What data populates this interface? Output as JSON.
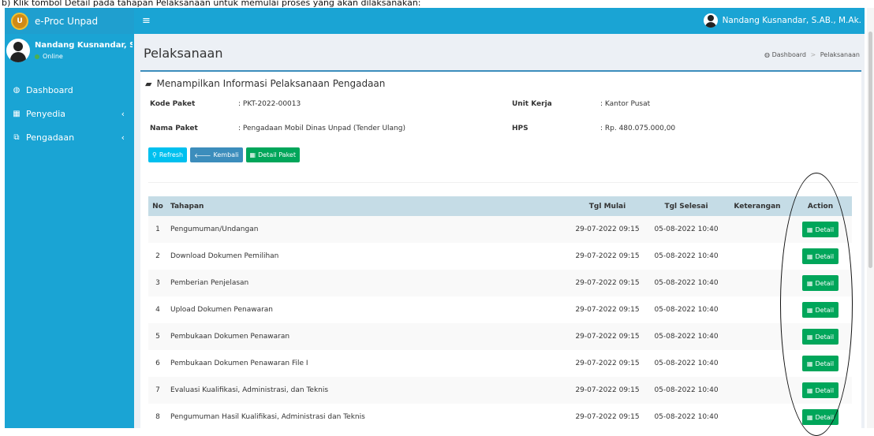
{
  "caption": "b) Klik tombol Detail pada tahapan Pelaksanaan untuk memulai proses yang akan dilaksanakan:",
  "brand": {
    "name": "e-Proc Unpad",
    "logo_text": "U"
  },
  "sidebar": {
    "user_name": "Nandang Kusnandar, S.AB.",
    "status": "Online",
    "menu": [
      {
        "icon": "dashboard-icon",
        "glyph": "◍",
        "label": "Dashboard",
        "chevron": ""
      },
      {
        "icon": "calendar-icon",
        "glyph": "▦",
        "label": "Penyedia",
        "chevron": "‹"
      },
      {
        "icon": "external-link-icon",
        "glyph": "⧉",
        "label": "Pengadaan",
        "chevron": "‹"
      }
    ]
  },
  "topbar": {
    "menu_glyph": "≡",
    "user_name": "Nandang Kusnandar, S.AB., M.Ak."
  },
  "page": {
    "title": "Pelaksanaan",
    "breadcrumb": {
      "home": "Dashboard",
      "separator": ">",
      "current": "Pelaksanaan",
      "home_glyph": "◍"
    }
  },
  "box": {
    "title": "Menampilkan Informasi Pelaksanaan Pengadaan",
    "title_glyph": "▰",
    "info": {
      "kode_paket_label": "Kode Paket",
      "kode_paket_value": ": PKT-2022-00013",
      "nama_paket_label": "Nama Paket",
      "nama_paket_value": ": Pengadaan Mobil Dinas Unpad (Tender Ulang)",
      "unit_kerja_label": "Unit Kerja",
      "unit_kerja_value": ": Kantor Pusat",
      "hps_label": "HPS",
      "hps_value": ": Rp. 480.075.000,00"
    },
    "buttons": {
      "refresh": "Refresh",
      "refresh_glyph": "⚲",
      "kembali": "Kembali",
      "kembali_glyph": "🡐",
      "detail_paket": "Detail Paket",
      "detail_paket_glyph": "▦"
    }
  },
  "table": {
    "headers": {
      "no": "No",
      "tahapan": "Tahapan",
      "tgl_mulai": "Tgl Mulai",
      "tgl_selesai": "Tgl Selesai",
      "keterangan": "Keterangan",
      "action": "Action"
    },
    "action_label": "Detail",
    "action_glyph": "▦",
    "rows": [
      {
        "no": "1",
        "tahapan": "Pengumuman/Undangan",
        "mulai": "29-07-2022 09:15",
        "selesai": "05-08-2022 10:40",
        "keterangan": ""
      },
      {
        "no": "2",
        "tahapan": "Download Dokumen Pemilihan",
        "mulai": "29-07-2022 09:15",
        "selesai": "05-08-2022 10:40",
        "keterangan": ""
      },
      {
        "no": "3",
        "tahapan": "Pemberian Penjelasan",
        "mulai": "29-07-2022 09:15",
        "selesai": "05-08-2022 10:40",
        "keterangan": ""
      },
      {
        "no": "4",
        "tahapan": "Upload Dokumen Penawaran",
        "mulai": "29-07-2022 09:15",
        "selesai": "05-08-2022 10:40",
        "keterangan": ""
      },
      {
        "no": "5",
        "tahapan": "Pembukaan Dokumen Penawaran",
        "mulai": "29-07-2022 09:15",
        "selesai": "05-08-2022 10:40",
        "keterangan": ""
      },
      {
        "no": "6",
        "tahapan": "Pembukaan Dokumen Penawaran File I",
        "mulai": "29-07-2022 09:15",
        "selesai": "05-08-2022 10:40",
        "keterangan": ""
      },
      {
        "no": "7",
        "tahapan": "Evaluasi Kualifikasi, Administrasi, dan Teknis",
        "mulai": "29-07-2022 09:15",
        "selesai": "05-08-2022 10:40",
        "keterangan": ""
      },
      {
        "no": "8",
        "tahapan": "Pengumuman Hasil Kualifikasi, Administrasi dan Teknis",
        "mulai": "29-07-2022 09:15",
        "selesai": "05-08-2022 10:40",
        "keterangan": ""
      }
    ]
  }
}
